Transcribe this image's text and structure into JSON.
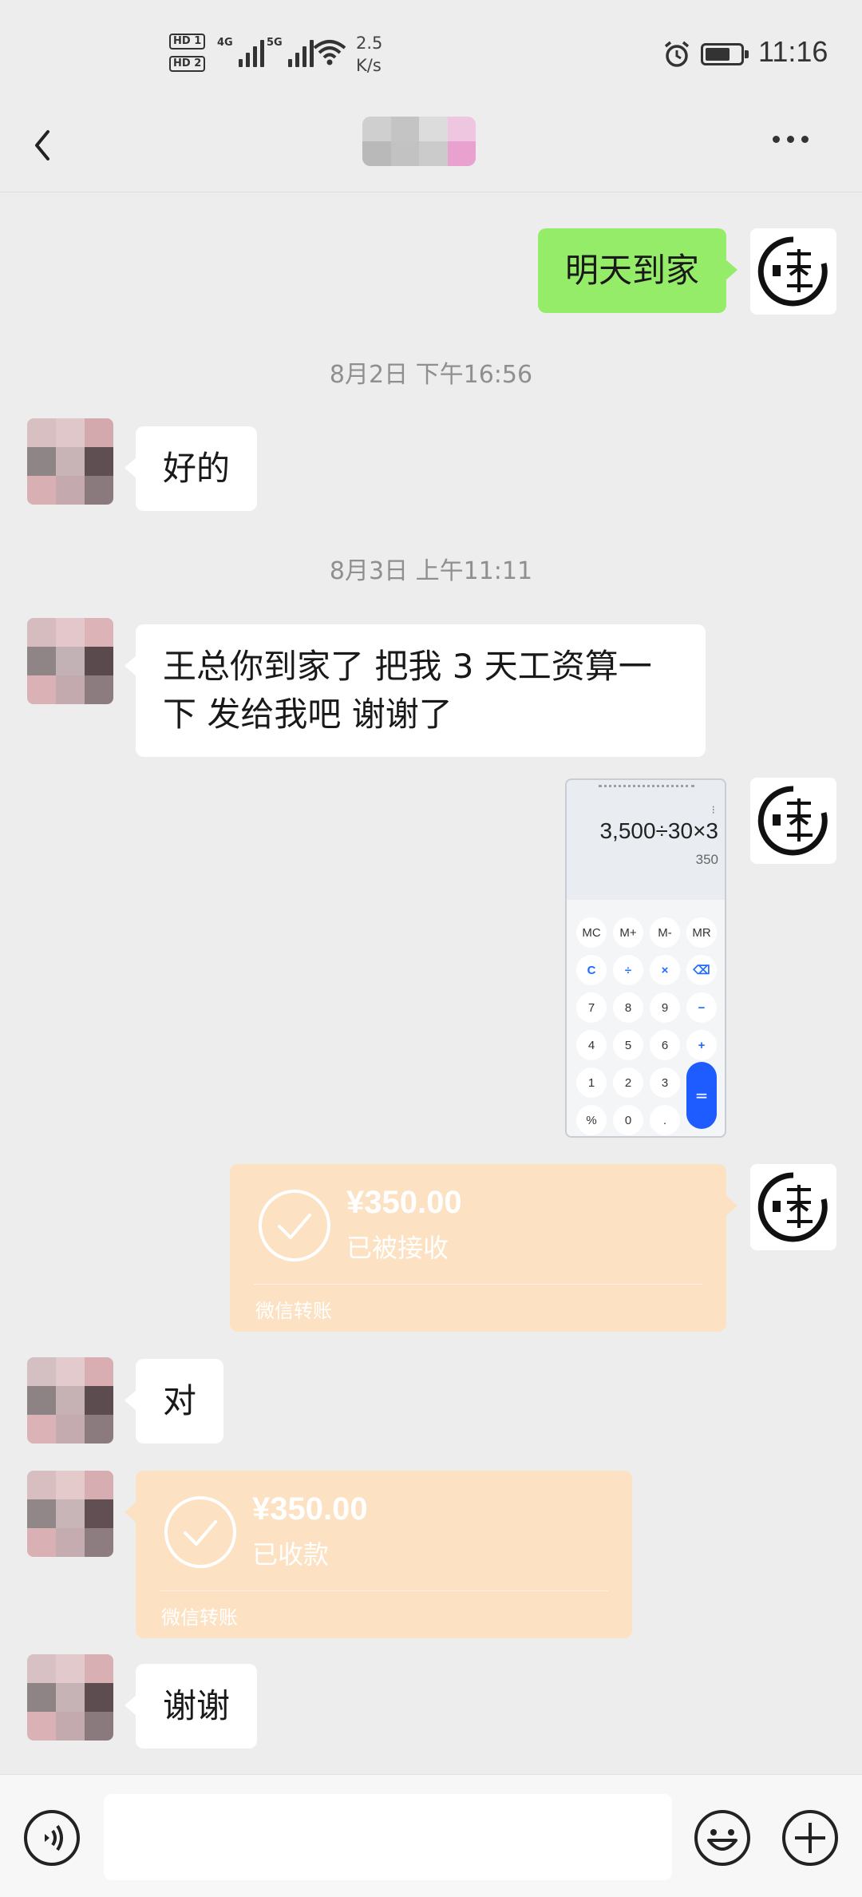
{
  "status_bar": {
    "hd1": "HD 1",
    "hd2": "HD 2",
    "network1": "4G",
    "network2": "5G",
    "speed_value": "2.5",
    "speed_unit": "K/s",
    "time": "11:16",
    "battery_level": 0.65
  },
  "nav": {
    "back_icon": "chevron-left-icon",
    "more_icon": "more-dots-icon"
  },
  "messages": {
    "m1_text": "明天到家",
    "ts1": "8月2日 下午16:56",
    "m2_text": "好的",
    "ts2": "8月3日 上午11:11",
    "m3_line1": "王总你到家了 把我 3 天工资算一",
    "m3_line2": "下 发给我吧   谢谢了",
    "m6_text": "对",
    "m8_text": "谢谢"
  },
  "calculator": {
    "expression": "3,500÷30×3",
    "result": "350",
    "keys": [
      "MC",
      "M+",
      "M-",
      "MR",
      "C",
      "÷",
      "×",
      "⌫",
      "7",
      "8",
      "9",
      "−",
      "4",
      "5",
      "6",
      "+",
      "1",
      "2",
      "3",
      "",
      "%",
      "0",
      "."
    ],
    "equals": "="
  },
  "transfers": {
    "t1_amount": "¥350.00",
    "t1_status": "已被接收",
    "t1_footer": "微信转账",
    "t2_amount": "¥350.00",
    "t2_status": "已收款",
    "t2_footer": "微信转账"
  },
  "input_bar": {
    "value": "",
    "placeholder": ""
  },
  "colors": {
    "background": "#ededed",
    "self_bubble": "#95ec69",
    "other_bubble": "#ffffff",
    "transfer_card": "#fce1c2",
    "calc_equals": "#1f5cff"
  }
}
